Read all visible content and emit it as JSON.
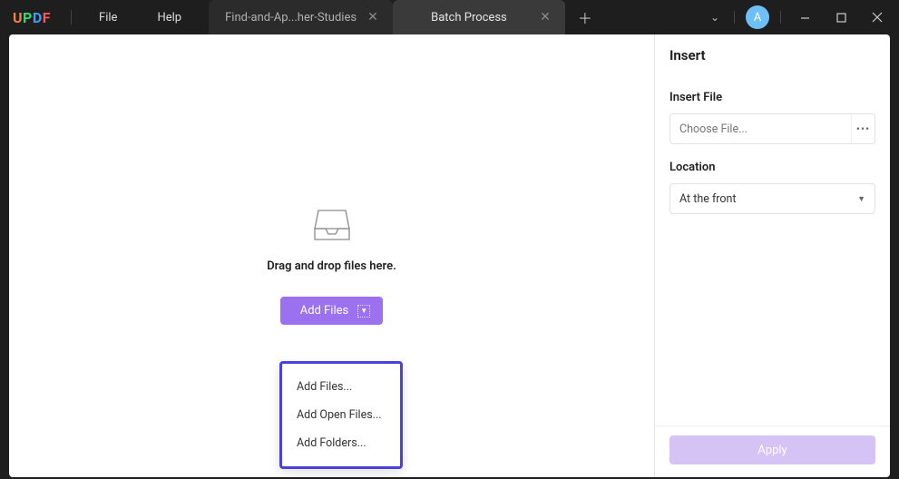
{
  "app": {
    "logo": "UPDF"
  },
  "menu": {
    "file": "File",
    "help": "Help"
  },
  "tabs": {
    "items": [
      {
        "label": "Find-and-Ap...her-Studies",
        "active": false
      },
      {
        "label": "Batch Process",
        "active": true
      }
    ]
  },
  "user": {
    "initial": "A"
  },
  "dropzone": {
    "instruction": "Drag and drop files here.",
    "add_button": "Add Files"
  },
  "add_menu": {
    "add_files": "Add Files...",
    "add_open": "Add Open Files...",
    "add_folders": "Add Folders..."
  },
  "sidebar": {
    "title": "Insert",
    "insert_file_label": "Insert File",
    "choose_placeholder": "Choose File...",
    "location_label": "Location",
    "location_value": "At the front",
    "apply": "Apply"
  }
}
